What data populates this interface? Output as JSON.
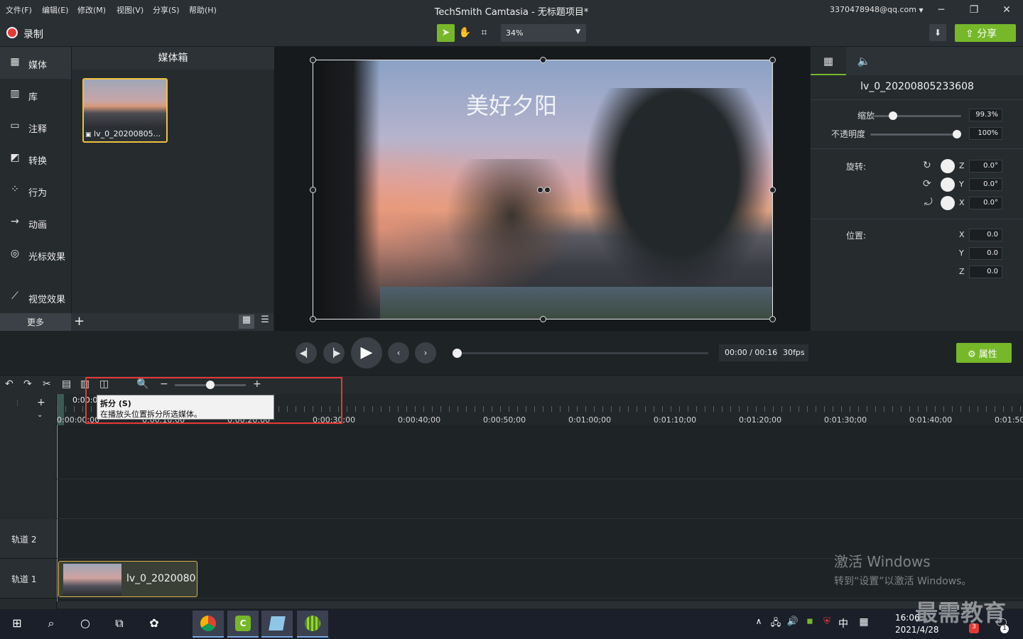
{
  "menu": [
    "文件(F)",
    "编辑(E)",
    "修改(M)",
    "视图(V)",
    "分享(S)",
    "帮助(H)"
  ],
  "app_title": "TechSmith Camtasia - 无标题项目*",
  "account": "3370478948@qq.com",
  "window_controls": {
    "minimize": "─",
    "restore": "❐",
    "close": "✕"
  },
  "toolbar": {
    "record_label": "录制",
    "zoom_value": "34%",
    "share_label": "分享",
    "accent_color": "#76b82a"
  },
  "sidebar": {
    "items": [
      {
        "label": "媒体",
        "icon": "media-icon"
      },
      {
        "label": "库",
        "icon": "library-icon"
      },
      {
        "label": "注释",
        "icon": "annotation-icon"
      },
      {
        "label": "转换",
        "icon": "transition-icon"
      },
      {
        "label": "行为",
        "icon": "behavior-icon"
      },
      {
        "label": "动画",
        "icon": "animation-icon"
      },
      {
        "label": "光标效果",
        "icon": "cursor-effect-icon"
      },
      {
        "label": "视觉效果",
        "icon": "visual-effect-icon"
      }
    ],
    "more_label": "更多"
  },
  "media_bin": {
    "header": "媒体箱",
    "thumb_caption": "lv_0_20200805..."
  },
  "canvas": {
    "video_title_text": "美好夕阳"
  },
  "properties": {
    "clip_name": "lv_0_20200805233608",
    "scale_label": "缩放",
    "scale_value": "99.3%",
    "scale_level": 0.993,
    "opacity_label": "不透明度",
    "opacity_value": "100%",
    "opacity_level": 1.0,
    "rotation_label": "旋转:",
    "rotation": [
      {
        "axis": "Z",
        "value": "0.0°"
      },
      {
        "axis": "Y",
        "value": "0.0°"
      },
      {
        "axis": "X",
        "value": "0.0°"
      }
    ],
    "position_label": "位置:",
    "position": [
      {
        "axis": "X",
        "value": "0.0"
      },
      {
        "axis": "Y",
        "value": "0.0"
      },
      {
        "axis": "Z",
        "value": "0.0"
      }
    ]
  },
  "player": {
    "timecode": "00:00 / 00:16",
    "fps": "30fps",
    "properties_button": "属性"
  },
  "timeline": {
    "tooltip_title": "拆分 (S)",
    "tooltip_desc": "在播放头位置拆分所选媒体。",
    "playhead_label": "0:00:0",
    "ruler_labels": [
      "0:00:00;00",
      "0:00:10;00",
      "0:00:20;00",
      "0:00:30;00",
      "0:00:40;00",
      "0:00:50;00",
      "0:01:00;00",
      "0:01:10;00",
      "0:01:20;00",
      "0:01:30;00",
      "0:01:40;00",
      "0:01:50;"
    ],
    "tracks": [
      {
        "label": "轨道 2"
      },
      {
        "label": "轨道 1"
      }
    ],
    "clip_name": "lv_0_2020080"
  },
  "windows_watermark": {
    "line1": "激活 Windows",
    "line2": "转到“设置”以激活 Windows。"
  },
  "taskbar": {
    "time": "16:06",
    "date": "2021/4/28",
    "ime": "中",
    "notification_count": "1",
    "badge_count": "3"
  },
  "brand_watermark": "最需教育"
}
